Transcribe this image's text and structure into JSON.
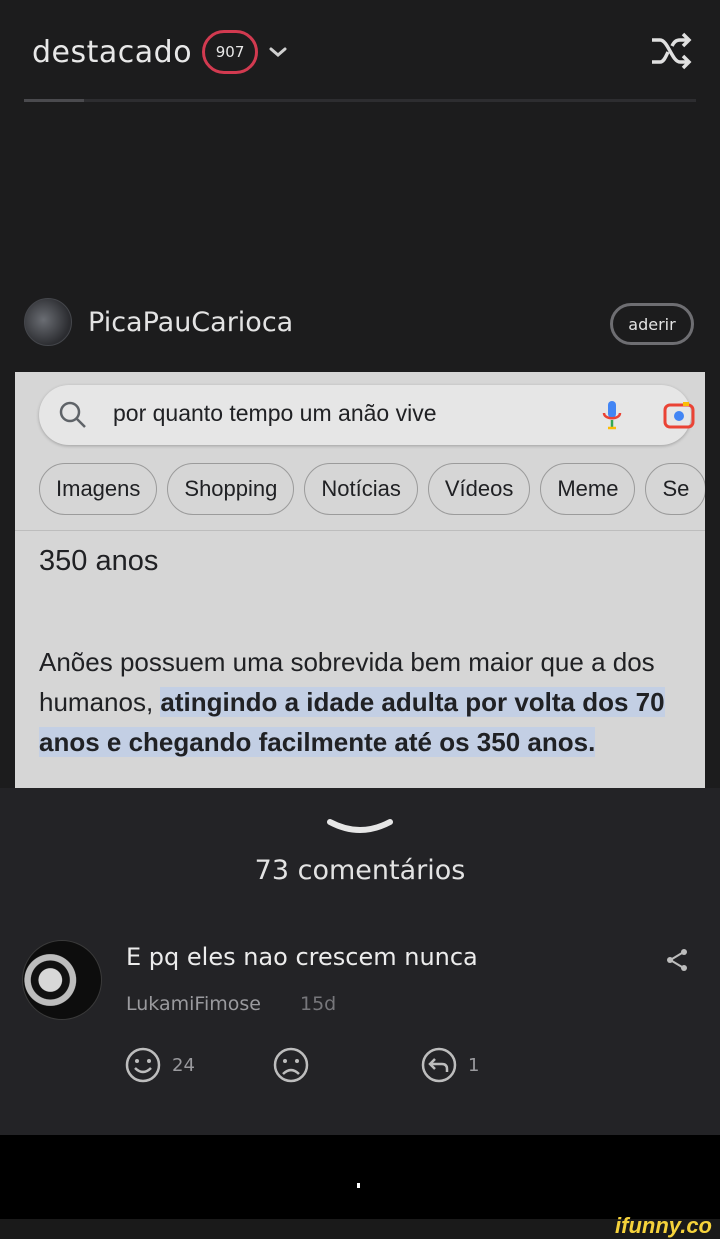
{
  "header": {
    "title": "destacado",
    "badge_count": "907"
  },
  "progress": {
    "fraction": 0.09
  },
  "author": {
    "name": "PicaPauCarioca",
    "subscribe_label": "aderir"
  },
  "post": {
    "search_query": "por quanto tempo um anão vive",
    "tabs": [
      "Imagens",
      "Shopping",
      "Notícias",
      "Vídeos",
      "Meme",
      "Se"
    ],
    "answer": "350 anos",
    "snippet_plain": "Anões possuem uma sobrevida bem maior que a dos humanos, ",
    "snippet_highlight": "atingindo a idade adulta por volta dos 70 anos e chegando facilmente até os 350 anos."
  },
  "comments": {
    "count_label": "73 comentários",
    "items": [
      {
        "text": "E pq eles nao crescem nunca",
        "user": "LukamiFimose",
        "time": "15d",
        "smiles": "24",
        "replies": "1"
      }
    ]
  },
  "watermark": "ifunny.co",
  "colors": {
    "badge_border": "#d23a50",
    "highlight": "#c3cfe4",
    "brand": "#f5d23b"
  }
}
